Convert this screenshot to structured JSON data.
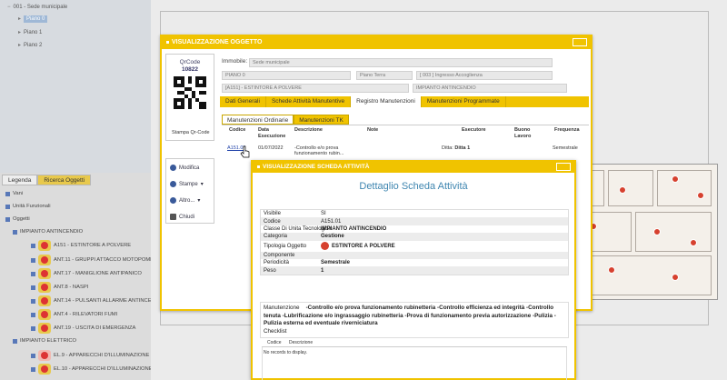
{
  "tree": {
    "items": [
      {
        "label": "001 - Sede municipale"
      },
      {
        "label": "Piano 0"
      },
      {
        "label": "Piano 1"
      },
      {
        "label": "Piano 2"
      }
    ]
  },
  "legend": {
    "tabs": [
      "Legenda",
      "Ricerca Oggetti"
    ],
    "rows": [
      "Vani",
      "Unità Funzionali",
      "Oggetti",
      "IMPIANTO ANTINCENDIO",
      "A151 - ESTINTORE A POLVERE",
      "ANT.11 - GRUPPI ATTACCO MOTOPOMPA",
      "ANT.17 - MANIGLIONE ANTIPANICO",
      "ANT.8 - NASPI",
      "ANT.14 - PULSANTI ALLARME ANTINCENDIO",
      "ANT.4 - RILEVATORI FUMI",
      "ANT.19 - USCITA DI EMERGENZA",
      "IMPIANTO ELETTRICO",
      "EL.9 - APPARECCHI D'ILLUMINAZIONE",
      "EL.10 - APPARECCHI D'ILLUMINAZIONE"
    ]
  },
  "dialog": {
    "title": "VISUALIZZAZIONE OGGETTO",
    "qr": {
      "label": "QrCode",
      "code": "10822",
      "button": "Stampa Qr-Code"
    },
    "side_buttons": [
      "Modifica",
      "Stampe",
      "Altro...",
      "Chiudi"
    ],
    "immobile_label": "Immobile:",
    "selects": {
      "immobile": "Sede municipale",
      "piano": "PIANO 0",
      "vano_type": "Piano Terra",
      "vano": "[ 003 ] Ingresso Accoglienza",
      "oggetto": "[A151] - ESTINTORE A POLVERE",
      "impianto": "IMPIANTO ANTINCENDIO"
    },
    "tabs": [
      "Dati Generali",
      "Schede Attività Manutentive",
      "Registro Manutenzioni",
      "Manutenzioni Programmate"
    ],
    "subtabs": [
      "Manutenzioni Ordinarie",
      "Manutenzioni TK"
    ],
    "grid_headers": [
      "Codice",
      "Data Esecuzione",
      "Descrizione",
      "Note",
      "Esecutore",
      "Buono Lavoro",
      "Frequenza"
    ],
    "grid_row": {
      "codice": "A151.01",
      "data": "01/07/2022",
      "descrizione": "-Controllo e/o prova funzionamento rubin...",
      "esecutore_prefix": "Ditta:",
      "esecutore": "Ditta 1",
      "frequenza": "Semestrale"
    }
  },
  "dialog2": {
    "title": "VISUALIZZAZIONE SCHEDA ATTIVITÀ",
    "heading": "Dettaglio Scheda Attività",
    "fields": [
      {
        "k": "Visibile",
        "v": "SI"
      },
      {
        "k": "Codice",
        "v": "A151.01"
      },
      {
        "k": "Classe Di Unita Tecnologica",
        "v": "IMPIANTO ANTINCENDIO"
      },
      {
        "k": "Categoria",
        "v": "Gestione"
      },
      {
        "k": "Tipologia Oggetto",
        "v": "ESTINTORE A POLVERE"
      },
      {
        "k": "Componente",
        "v": ""
      },
      {
        "k": "Periodicità",
        "v": "Semestrale"
      },
      {
        "k": "Peso",
        "v": "1"
      }
    ],
    "manutenzione_label": "Manutenzione",
    "manutenzione_text": "-Controllo e/o prova funzionamento rubinetteria -Controllo efficienza ed integrità -Controllo tenuta -Lubrificazione e/o ingrassaggio rubinetteria -Prova di funzionamento previa autorizzazione -Pulizia -Pulizia esterna ed eventuale riverniciatura",
    "checklist_label": "Checklist",
    "checklist_headers": [
      "Codice",
      "Descrizione"
    ],
    "no_records": "No records to display."
  },
  "colors": {
    "accent": "#f0c300",
    "link": "#2244aa",
    "heading": "#3f86b0",
    "marker": "#d6412f"
  },
  "icons": [
    "extinguisher-icon",
    "qr-code-icon",
    "edit-icon",
    "print-icon",
    "more-icon",
    "close-icon",
    "cursor-icon"
  ]
}
